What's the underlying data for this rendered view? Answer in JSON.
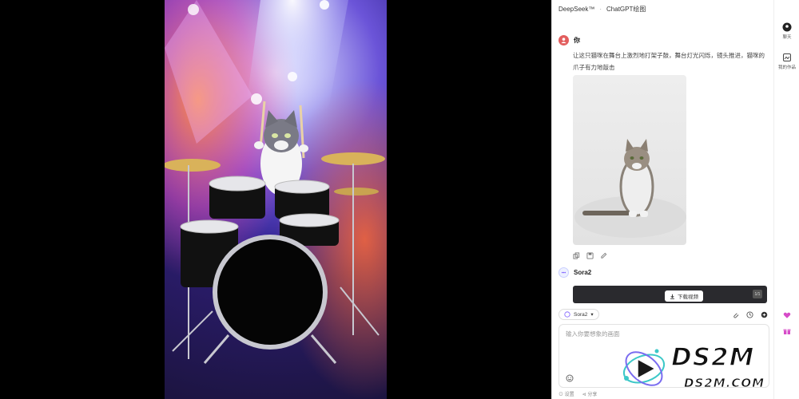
{
  "viewer": {
    "subject": "video-frame"
  },
  "panel": {
    "topbar": {
      "app_name": "DeepSeek™",
      "separator": "·",
      "model_title": "ChatGPT绘图"
    },
    "user_message": {
      "author": "你",
      "prompt": "让这只猫咪在舞台上激烈地打架子鼓，舞台灯光闪烁，镜头推进，猫咪的爪子有力地敲击"
    },
    "bot_message": {
      "author": "Sora2"
    },
    "video_result": {
      "download_label": "下载视频",
      "badge": "1/1"
    },
    "model_selector": {
      "label": "Sora2",
      "chevron": "▾"
    },
    "composer": {
      "placeholder": "输入你要想象的画面"
    },
    "footer": {
      "left": "⊙ 设置",
      "right": "⊲ 分享"
    }
  },
  "rail": [
    {
      "label": "聊天"
    },
    {
      "label": "我的作品"
    }
  ],
  "watermark": {
    "brand": "DS2M",
    "site": "DS2M.COM"
  },
  "colors": {
    "accent": "#7b5cff",
    "user_avatar": "#e25d5d",
    "heart": "#d64bc8"
  }
}
